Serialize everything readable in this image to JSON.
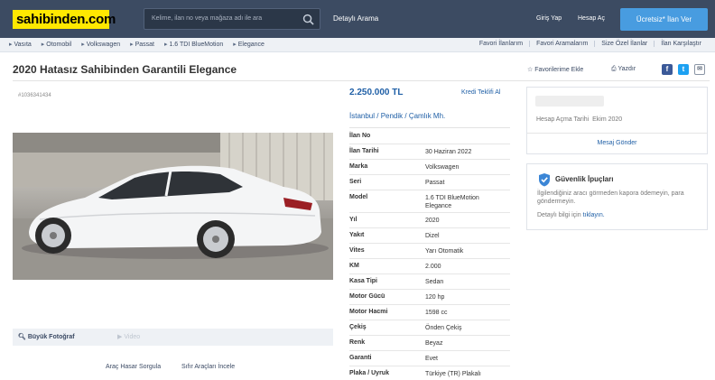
{
  "header": {
    "logo": "sahibinden.com",
    "search_placeholder": "Kelime, ilan no veya mağaza adı ile ara",
    "advanced_search": "Detaylı Arama",
    "login": "Giriş Yap",
    "register": "Hesap Aç",
    "post_ad": "Ücretsiz* İlan Ver"
  },
  "breadcrumb": [
    "Vasıta",
    "Otomobil",
    "Volkswagen",
    "Passat",
    "1.6 TDI BlueMotion",
    "Elegance"
  ],
  "top_links": [
    "Favori İlanlarım",
    "Favori Aramalarım",
    "Size Özel İlanlar",
    "İlan Karşılaştır"
  ],
  "listing": {
    "title": "2020 Hatasız Sahibinden Garantili Elegance",
    "add_favorite": "Favorilerime Ekle",
    "print": "Yazdır",
    "listing_id_small": "#1036341434",
    "price": "2.250.000 TL",
    "credit_link": "Kredi Teklifi Al",
    "location": "İstanbul  /  Pendik  /  Çamlık Mh.",
    "big_photo": "Büyük Fotoğraf",
    "video": "Video",
    "damage_query": "Araç Hasar Sorgula",
    "zero_cars": "Sıfır Araçları İncele"
  },
  "details": [
    {
      "key": "İlan No",
      "value": ""
    },
    {
      "key": "İlan Tarihi",
      "value": "30 Haziran 2022"
    },
    {
      "key": "Marka",
      "value": "Volkswagen"
    },
    {
      "key": "Seri",
      "value": "Passat"
    },
    {
      "key": "Model",
      "value": "1.6 TDI BlueMotion Elegance"
    },
    {
      "key": "Yıl",
      "value": "2020"
    },
    {
      "key": "Yakıt",
      "value": "Dizel"
    },
    {
      "key": "Vites",
      "value": "Yarı Otomatik"
    },
    {
      "key": "KM",
      "value": "2.000"
    },
    {
      "key": "Kasa Tipi",
      "value": "Sedan"
    },
    {
      "key": "Motor Gücü",
      "value": "120 hp"
    },
    {
      "key": "Motor Hacmi",
      "value": "1598 cc"
    },
    {
      "key": "Çekiş",
      "value": "Önden Çekiş"
    },
    {
      "key": "Renk",
      "value": "Beyaz"
    },
    {
      "key": "Garanti",
      "value": "Evet"
    },
    {
      "key": "Plaka / Uyruk",
      "value": "Türkiye (TR) Plakalı"
    }
  ],
  "seller": {
    "account_opened_label": "Hesap Açma Tarihi",
    "account_opened_date": "Ekim 2020",
    "send_message": "Mesaj Gönder"
  },
  "safety": {
    "title": "Güvenlik İpuçları",
    "text": "İlgilendiğiniz aracı görmeden kapora ödemeyin, para göndermeyin.",
    "more_prefix": "Detaylı bilgi için",
    "more_link": "tıklayın."
  },
  "colors": {
    "header_bg": "#3c4b62",
    "logo_bg": "#ffe800",
    "accent_button": "#489ce0",
    "link": "#1f5fa6"
  },
  "icons": [
    "search-icon",
    "star-icon",
    "printer-icon",
    "facebook-icon",
    "twitter-icon",
    "email-icon",
    "magnifier-icon",
    "play-icon",
    "shield-icon"
  ]
}
